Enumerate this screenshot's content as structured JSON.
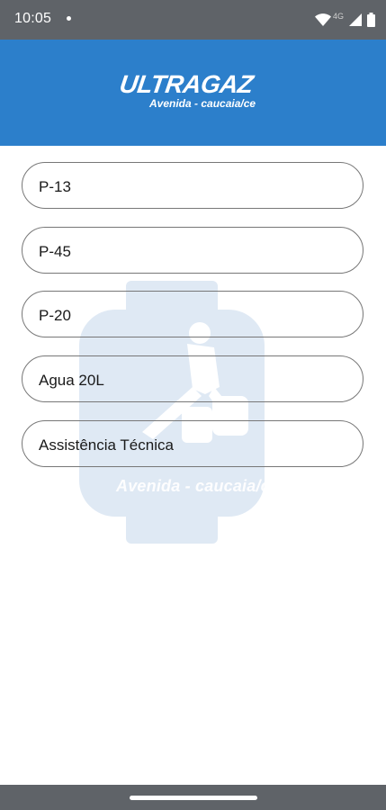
{
  "status_bar": {
    "time": "10:05",
    "network": "4G",
    "icons": [
      "notification-dot-icon",
      "wifi-icon",
      "signal-icon",
      "battery-icon"
    ]
  },
  "header": {
    "logo_text": "ULTRAGAZ",
    "subtitle": "Avenida - caucaia/ce",
    "background_color": "#2c7fcb"
  },
  "watermark": {
    "text": "Avenida - caucaia/ce"
  },
  "menu": {
    "items": [
      {
        "label": "P-13"
      },
      {
        "label": "P-45"
      },
      {
        "label": "P-20"
      },
      {
        "label": "Agua 20L"
      },
      {
        "label": "Assistência Técnica"
      }
    ]
  }
}
